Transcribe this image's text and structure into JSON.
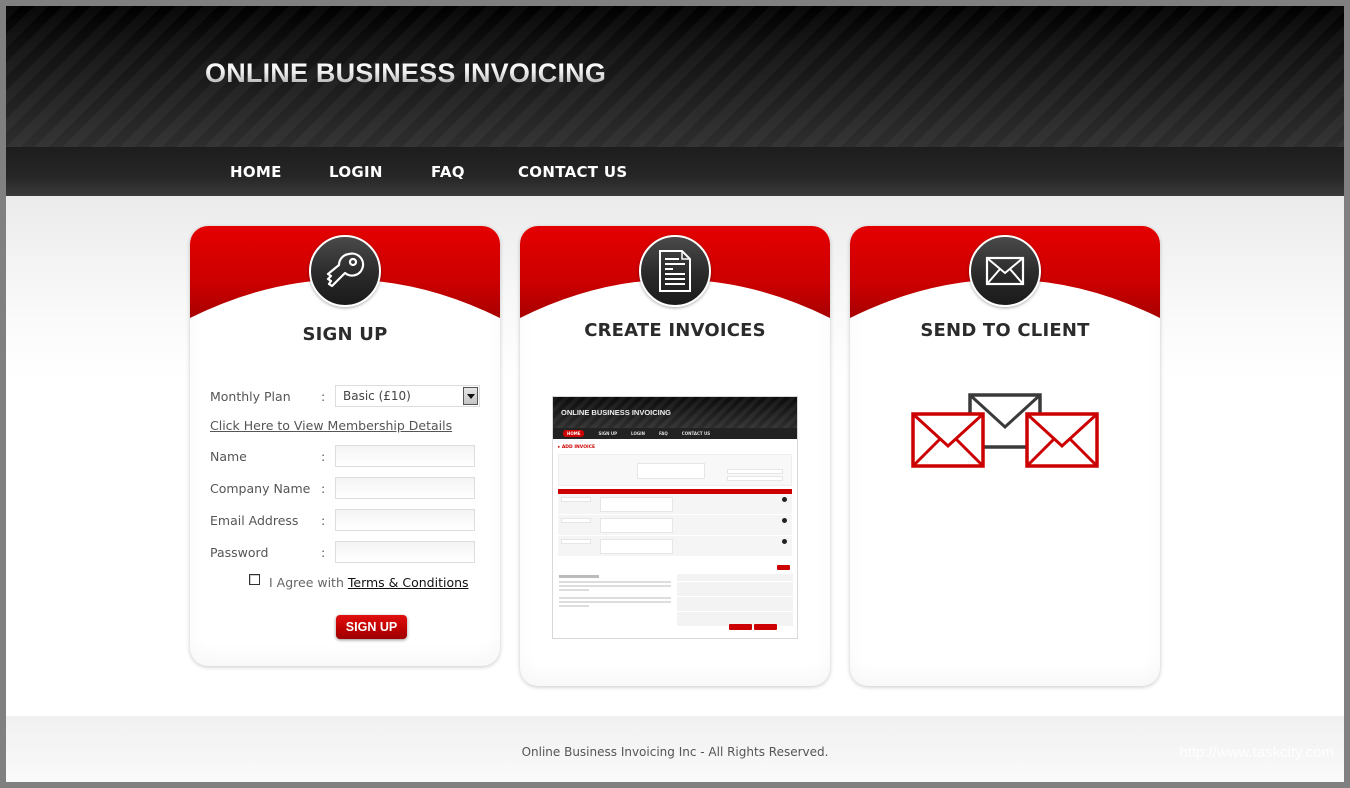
{
  "header": {
    "site_title": "ONLINE BUSINESS INVOICING"
  },
  "nav": {
    "items": [
      {
        "label": "HOME"
      },
      {
        "label": "LOGIN"
      },
      {
        "label": "FAQ"
      },
      {
        "label": "CONTACT US"
      }
    ]
  },
  "cards": {
    "signup": {
      "icon": "key-icon",
      "title": "SIGN UP",
      "form": {
        "monthly_plan_label": "Monthly Plan",
        "monthly_plan_value": "Basic (£10)",
        "membership_link": "Click Here to View Membership Details",
        "name_label": "Name",
        "company_label": "Company Name",
        "email_label": "Email Address",
        "password_label": "Password",
        "colon": ":",
        "agree_text": "I Agree with",
        "terms_link": "Terms & Conditions",
        "agree_checked": false,
        "submit_label": "SIGN UP"
      }
    },
    "create": {
      "icon": "document-icon",
      "title": "CREATE INVOICES",
      "preview": {
        "site_title": "ONLINE BUSINESS INVOICING",
        "nav": [
          "HOME",
          "SIGN UP",
          "LOGIN",
          "FAQ",
          "CONTACT US"
        ],
        "section_title": "▸ ADD INVOICE"
      }
    },
    "send": {
      "icon": "envelope-icon",
      "title": "SEND TO CLIENT"
    }
  },
  "colors": {
    "accent_red": "#d80000",
    "dark": "#2b2b2b"
  },
  "footer": {
    "copyright": "Online Business Invoicing Inc - All Rights Reserved.",
    "watermark": "http://www.taskcity.com"
  }
}
